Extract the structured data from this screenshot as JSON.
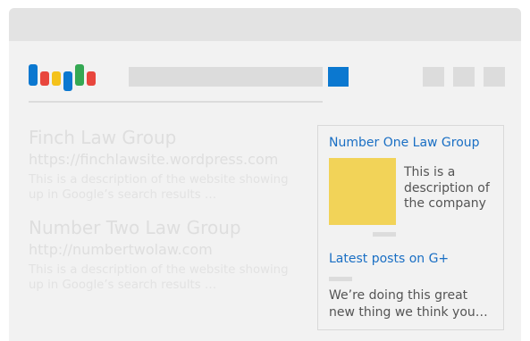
{
  "browser": {
    "logo_colors": [
      "#0b78d0",
      "#e8463d",
      "#f4c21b",
      "#0b78d0",
      "#34a853",
      "#e8463d"
    ]
  },
  "search": {
    "button_color": "#0b78d0"
  },
  "results": [
    {
      "title": "Finch Law Group",
      "url": "https://finchlawsite.wordpress.com",
      "description_line1": "This is a description of the website showing",
      "description_line2": "up in Google’s search results …"
    },
    {
      "title": "Number Two Law Group",
      "url": "http://numbertwolaw.com",
      "description_line1": "This is a description of the website showing",
      "description_line2": "up in Google’s search results …"
    }
  ],
  "knowledge_panel": {
    "title": "Number One Law Group",
    "image_color": "#f2d358",
    "description_lines": [
      "This is a",
      "description of",
      "the company"
    ],
    "posts_heading": "Latest posts on G+",
    "post_lines": [
      "We’re doing this great",
      "new thing we think you…"
    ]
  }
}
